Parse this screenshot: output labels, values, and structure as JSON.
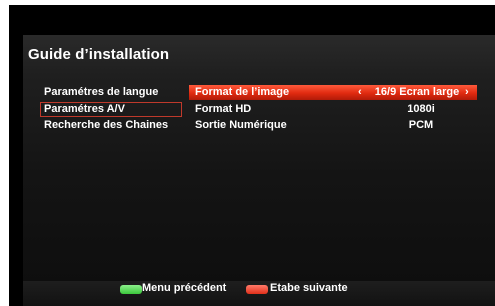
{
  "title": "Guide d’installation",
  "menu": [
    {
      "label": "Paramétres de langue",
      "selected": false
    },
    {
      "label": "Paramétres A/V",
      "selected": true
    },
    {
      "label": "Recherche des Chaines",
      "selected": false
    }
  ],
  "settings": [
    {
      "label": "Format de l’image",
      "value": "16/9 Ecran large",
      "highlighted": true,
      "left_arrow": "‹",
      "right_arrow": "›"
    },
    {
      "label": "Format HD",
      "value": "1080i",
      "highlighted": false
    },
    {
      "label": "Sortie Numérique",
      "value": "PCM",
      "highlighted": false
    }
  ],
  "footer": {
    "green_key_color": "#3cc83c",
    "red_key_color": "#e0301a",
    "previous_menu_label": "Menu précédent",
    "next_step_label": "Etabe suivante"
  }
}
